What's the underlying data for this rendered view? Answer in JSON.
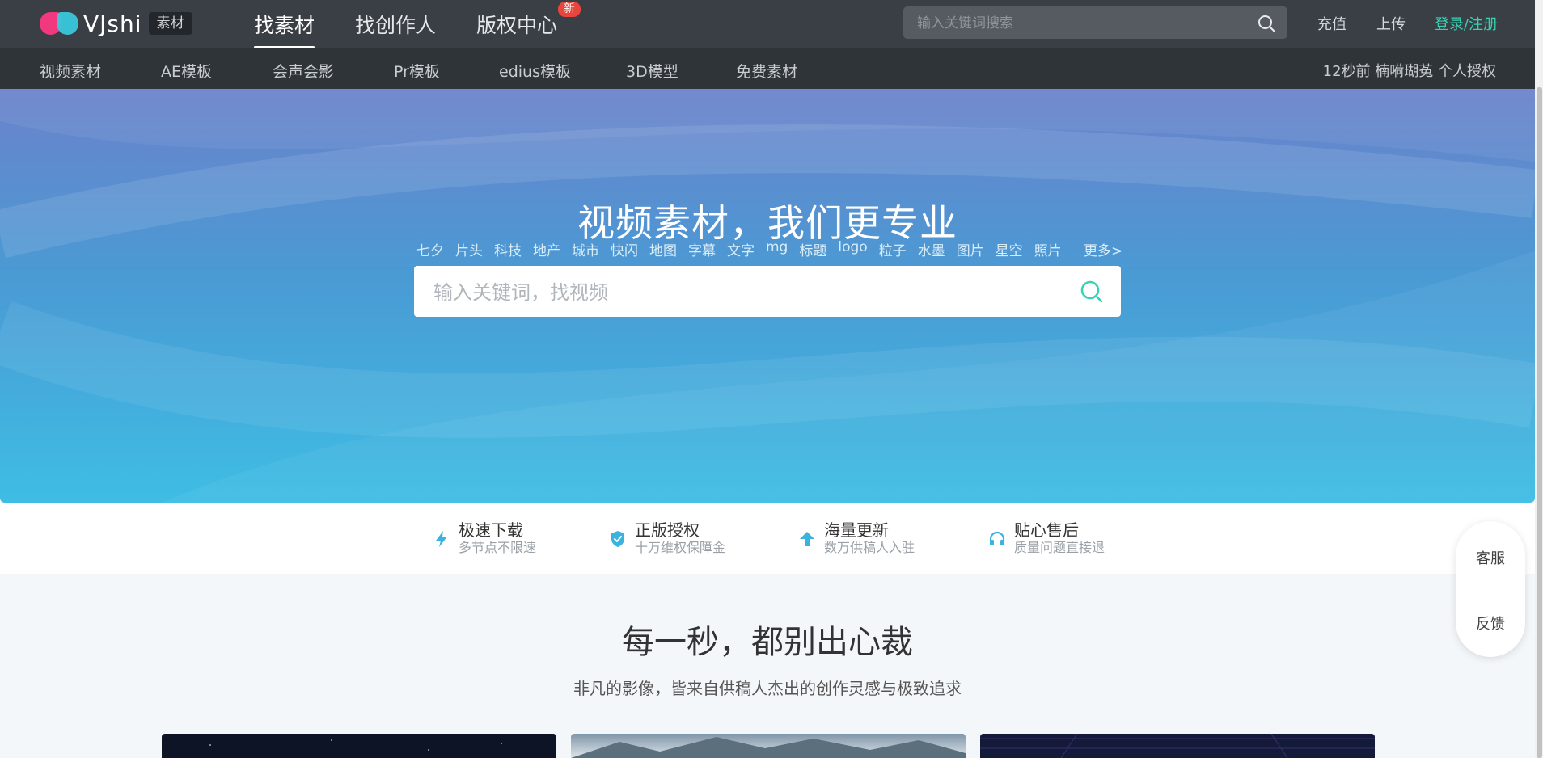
{
  "header": {
    "logo_text": "VJshi",
    "logo_badge": "素材",
    "nav": [
      "找素材",
      "找创作人",
      "版权中心"
    ],
    "new_badge": "新",
    "search_placeholder": "输入关键词搜索",
    "links": {
      "recharge": "充值",
      "upload": "上传",
      "login": "登录/注册"
    }
  },
  "subnav": {
    "items": [
      "视频素材",
      "AE模板",
      "会声会影",
      "Pr模板",
      "edius模板",
      "3D模型",
      "免费素材"
    ],
    "news": "12秒前 楠嗬瑚菟 个人授权"
  },
  "hero": {
    "title": "视频素材，我们更专业",
    "search_placeholder": "输入关键词，找视频",
    "tags": [
      "七夕",
      "片头",
      "科技",
      "地产",
      "城市",
      "快闪",
      "地图",
      "字幕",
      "文字",
      "mg",
      "标题",
      "logo",
      "粒子",
      "水墨",
      "图片",
      "星空",
      "照片"
    ],
    "more": "更多>"
  },
  "features": [
    {
      "title": "极速下载",
      "sub": "多节点不限速",
      "icon": "lightning-icon"
    },
    {
      "title": "正版授权",
      "sub": "十万维权保障金",
      "icon": "shield-check-icon"
    },
    {
      "title": "海量更新",
      "sub": "数万供稿人入驻",
      "icon": "arrow-up-icon"
    },
    {
      "title": "贴心售后",
      "sub": "质量问题直接退",
      "icon": "headset-icon"
    }
  ],
  "section": {
    "title": "每一秒，都别出心裁",
    "subtitle": "非凡的影像，皆来自供稿人杰出的创作灵感与极致追求"
  },
  "side_widget": {
    "service": "客服",
    "feedback": "反馈"
  },
  "colors": {
    "accent": "#35d3b4",
    "topbar": "#3a3f45",
    "subnav": "#2f3439",
    "feature_icon": "#3ab3e0"
  }
}
